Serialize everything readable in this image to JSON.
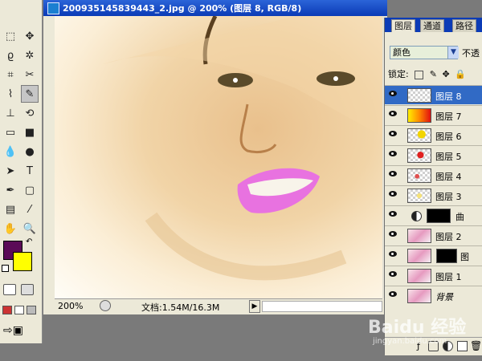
{
  "document": {
    "title": "200935145839443_2.jpg @ 200% (图层 8, RGB/8)",
    "zoom": "200%",
    "doc_size": "文档:1.54M/16.3M"
  },
  "colors": {
    "foreground": "#5b0b57",
    "background": "#ffff00",
    "accent": "#316ac5"
  },
  "toolbox": {
    "tools": [
      "marquee-icon",
      "move-icon",
      "lasso-icon",
      "magic-wand-icon",
      "crop-icon",
      "slice-icon",
      "healing-brush-icon",
      "brush-icon",
      "clone-stamp-icon",
      "history-brush-icon",
      "eraser-icon",
      "gradient-icon",
      "blur-icon",
      "dodge-icon",
      "path-selection-icon",
      "type-icon",
      "pen-icon",
      "rectangle-icon",
      "notes-icon",
      "eyedropper-icon",
      "hand-icon",
      "zoom-icon"
    ],
    "glyphs": [
      "⬚",
      "✥",
      "ϱ",
      "✲",
      "⌗",
      "✂",
      "⌇",
      "✎",
      "⊥",
      "⟲",
      "▭",
      "■",
      "💧",
      "●",
      "➤",
      "T",
      "✒",
      "▢",
      "▤",
      "⁄",
      "✋",
      "🔍"
    ]
  },
  "layers_panel": {
    "tabs": [
      "图层",
      "通道",
      "路径"
    ],
    "blend_mode": "颜色",
    "opacity_label": "不透",
    "lock_label": "锁定:",
    "layers": [
      {
        "name": "图层 8",
        "thumb": "transparent",
        "selected": true
      },
      {
        "name": "图层 7",
        "thumb": "yellow-red-gradient"
      },
      {
        "name": "图层 6",
        "thumb": "yellow-marks"
      },
      {
        "name": "图层 5",
        "thumb": "red-marks"
      },
      {
        "name": "图层 4",
        "thumb": "red-faint"
      },
      {
        "name": "图层 3",
        "thumb": "yellow-faint"
      },
      {
        "name": "曲",
        "thumb": "curves-adjustment"
      },
      {
        "name": "图层 2",
        "thumb": "photo"
      },
      {
        "name": "图",
        "thumb": "photo-mask"
      },
      {
        "name": "图层 1",
        "thumb": "photo"
      },
      {
        "name": "背景",
        "thumb": "photo",
        "italic": true
      }
    ]
  },
  "watermark": {
    "text": "Baidu 经验",
    "sub": "jingyan.baidu.com"
  }
}
